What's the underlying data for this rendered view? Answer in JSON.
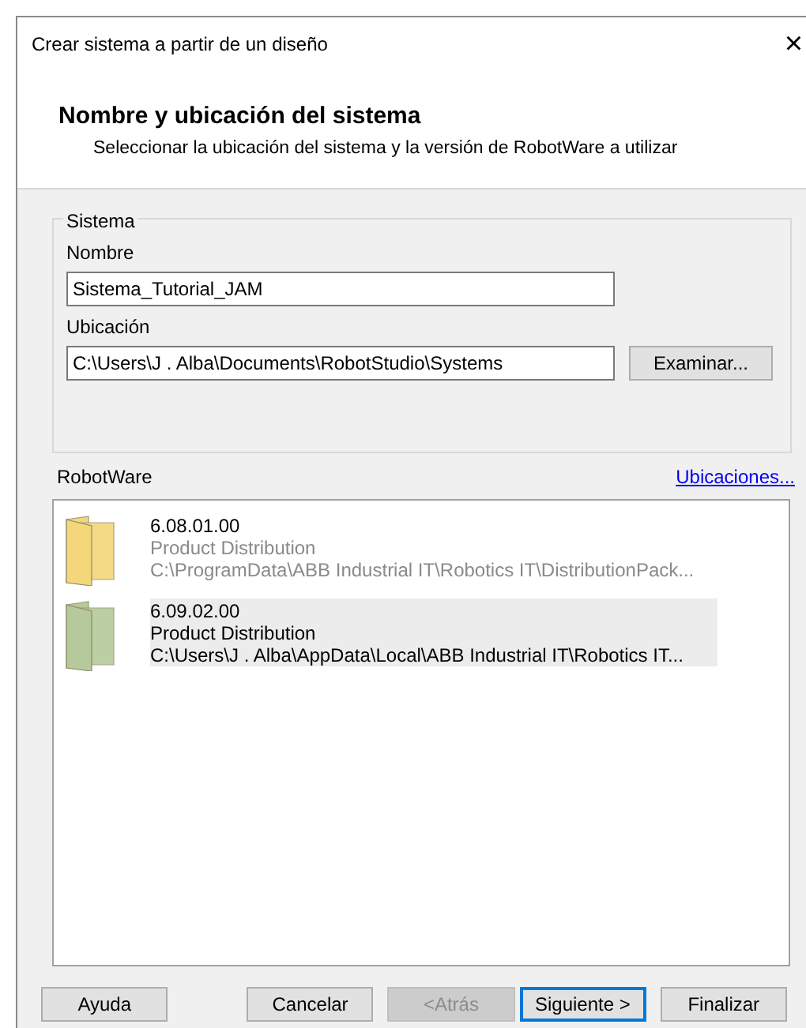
{
  "window": {
    "title": "Crear sistema a partir de un diseño",
    "close": "×"
  },
  "header": {
    "title": "Nombre y ubicación del sistema",
    "subtitle": "Seleccionar la ubicación del sistema y la versión de RobotWare a utilizar"
  },
  "system_group": {
    "legend": "Sistema",
    "name_label": "Nombre",
    "name_value": "Sistema_Tutorial_JAM",
    "location_label": "Ubicación",
    "location_value": "C:\\Users\\J . Alba\\Documents\\RobotStudio\\Systems",
    "browse_button": "Examinar..."
  },
  "robotware": {
    "label": "RobotWare",
    "link": "Ubicaciones...",
    "items": [
      {
        "version": "6.08.01.00",
        "type": "Product Distribution",
        "path": "C:\\ProgramData\\ABB Industrial IT\\Robotics IT\\DistributionPack...",
        "selected": false,
        "color": "#f3d77a"
      },
      {
        "version": "6.09.02.00",
        "type": "Product Distribution",
        "path": "C:\\Users\\J . Alba\\AppData\\Local\\ABB Industrial IT\\Robotics IT...",
        "selected": true,
        "color": "#b5c99a"
      }
    ]
  },
  "buttons": [
    {
      "label": "Ayuda",
      "disabled": false,
      "default": false
    },
    {
      "label": "Cancelar",
      "disabled": false,
      "default": false
    },
    {
      "label": "<Atrás",
      "disabled": true,
      "default": false
    },
    {
      "label": "Siguiente >",
      "disabled": false,
      "default": true
    },
    {
      "label": "Finalizar",
      "disabled": false,
      "default": false
    }
  ]
}
